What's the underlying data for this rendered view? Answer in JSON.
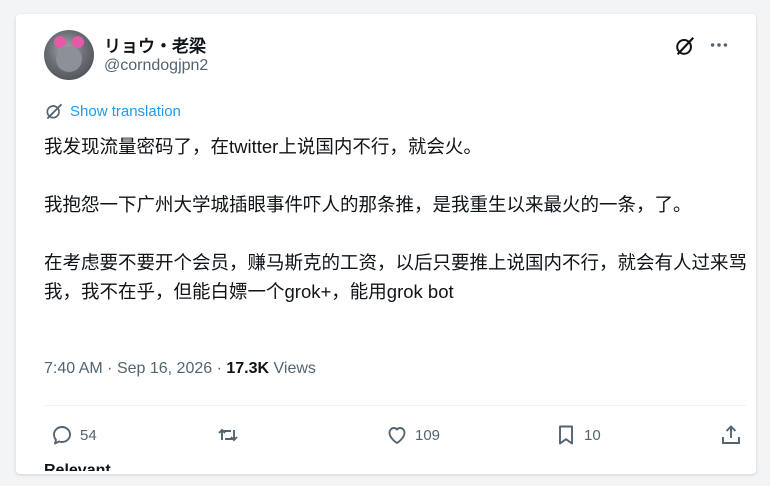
{
  "tweet": {
    "author_name": "リョウ・老梁",
    "author_handle": "@corndogjpn2",
    "show_translation": "Show translation",
    "paragraphs": [
      "我发现流量密码了，在twitter上说国内不行，就会火。",
      "我抱怨一下广州大学城插眼事件吓人的那条推，是我重生以来最火的一条，了。",
      "在考虑要不要开个会员，赚马斯克的工资，以后只要推上说国内不行，就会有人过来骂我，我不在乎，但能白嫖一个grok+，能用grok bot"
    ],
    "time": "7:40 AM",
    "separator": "·",
    "date": "Sep 16, 2026",
    "views_count": "17.3K",
    "views_label": "Views",
    "replies": "54",
    "reposts": "",
    "likes": "109",
    "bookmarks": "10",
    "cutoff_text": "Relevant"
  },
  "colors": {
    "accent": "#1d9bf0",
    "text": "#0f1419",
    "muted": "#536471"
  },
  "icons": [
    "grok-icon",
    "more-icon",
    "translate-icon",
    "reply-icon",
    "repost-icon",
    "like-icon",
    "bookmark-icon",
    "share-icon"
  ]
}
